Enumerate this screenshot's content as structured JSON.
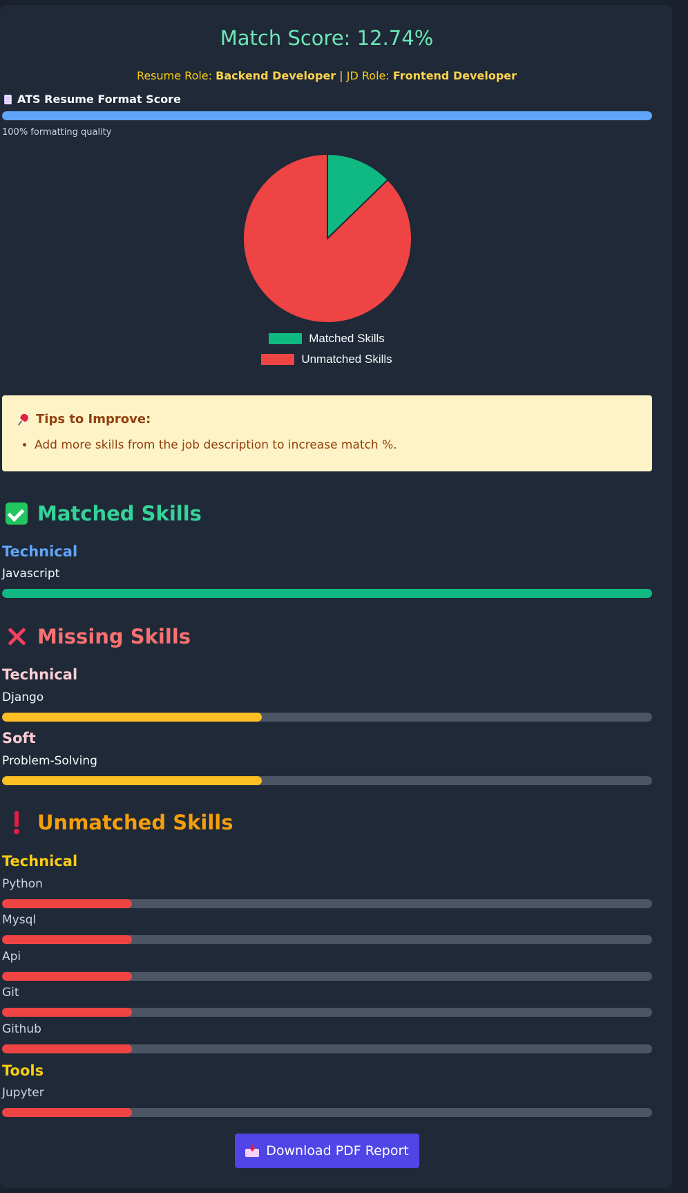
{
  "header": {
    "match_score": "Match Score: 12.74%",
    "resume_role_label": "Resume Role:",
    "resume_role": "Backend Developer",
    "separator": "|",
    "jd_role_label": "JD Role:",
    "jd_role": "Frontend Developer"
  },
  "ats": {
    "title": "ATS Resume Format Score",
    "icon": "document-icon",
    "percent": 100,
    "caption": "100% formatting quality",
    "color": "#60a5fa"
  },
  "chart_data": {
    "type": "pie",
    "labels": [
      "Matched Skills",
      "Unmatched Skills"
    ],
    "values": [
      12.74,
      87.26
    ],
    "colors": [
      "#10b981",
      "#ef4444"
    ],
    "legend": "bottom"
  },
  "tips": {
    "icon": "pushpin-icon",
    "title": "Tips to Improve:",
    "items": [
      "Add more skills from the job description to increase match %."
    ]
  },
  "matched": {
    "icon": "check-icon",
    "title": "Matched Skills",
    "title_color": "#34d399",
    "groups": [
      {
        "category": "Technical",
        "color": "#60a5fa",
        "skills": [
          {
            "name": "Javascript",
            "level": 1.0,
            "fill": "#10b981"
          }
        ]
      }
    ]
  },
  "missing": {
    "icon": "cross-icon",
    "title": "Missing Skills",
    "title_color": "#f87171",
    "groups": [
      {
        "category": "Technical",
        "color": "#fecdd3",
        "skills": [
          {
            "name": "Django",
            "level": 0.4,
            "fill": "#fbbf24"
          }
        ]
      },
      {
        "category": "Soft",
        "color": "#fecdd3",
        "skills": [
          {
            "name": "Problem-Solving",
            "level": 0.4,
            "fill": "#fbbf24"
          }
        ]
      }
    ]
  },
  "unmatched": {
    "icon": "exclamation-icon",
    "title": "Unmatched Skills",
    "title_color": "#f59e0b",
    "groups": [
      {
        "category": "Technical",
        "color": "#facc15",
        "skills": [
          {
            "name": "Python",
            "level": 0.2,
            "fill": "#ef4444"
          },
          {
            "name": "Mysql",
            "level": 0.2,
            "fill": "#ef4444"
          },
          {
            "name": "Api",
            "level": 0.2,
            "fill": "#ef4444"
          },
          {
            "name": "Git",
            "level": 0.2,
            "fill": "#ef4444"
          },
          {
            "name": "Github",
            "level": 0.2,
            "fill": "#ef4444"
          }
        ]
      },
      {
        "category": "Tools",
        "color": "#facc15",
        "skills": [
          {
            "name": "Jupyter",
            "level": 0.2,
            "fill": "#ef4444"
          }
        ]
      }
    ]
  },
  "download": {
    "label": "Download PDF Report",
    "icon": "inbox-tray-icon"
  }
}
